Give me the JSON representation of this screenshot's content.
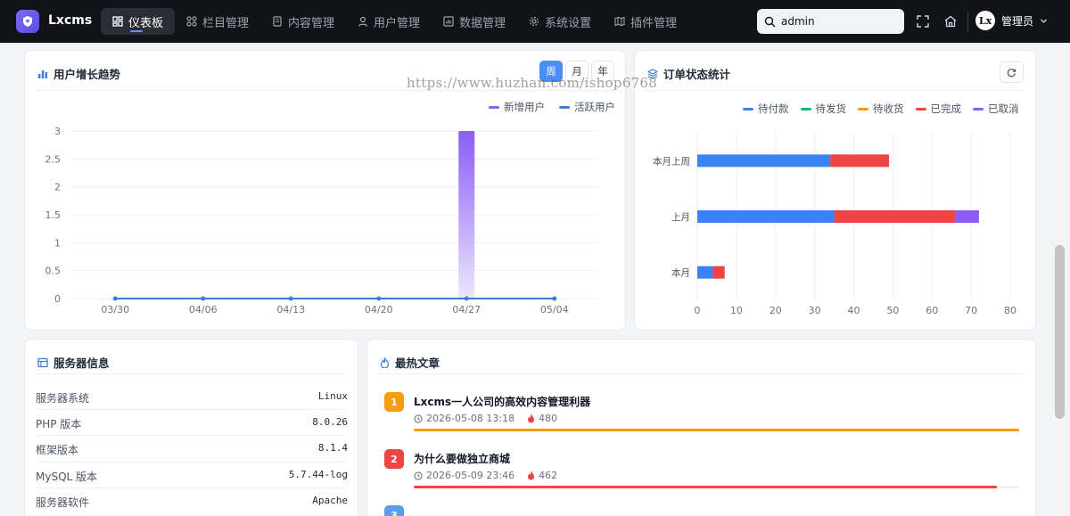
{
  "app": {
    "brand": "Lxcms"
  },
  "nav": [
    {
      "label": "仪表板",
      "icon": "dashboard-icon",
      "active": true
    },
    {
      "label": "栏目管理",
      "icon": "grid-icon"
    },
    {
      "label": "内容管理",
      "icon": "document-icon"
    },
    {
      "label": "用户管理",
      "icon": "user-icon"
    },
    {
      "label": "数据管理",
      "icon": "chart-icon"
    },
    {
      "label": "系统设置",
      "icon": "gear-icon"
    },
    {
      "label": "插件管理",
      "icon": "map-icon"
    }
  ],
  "search": {
    "value": "admin"
  },
  "user": {
    "name": "管理员",
    "avatar_text": "Lx"
  },
  "watermark": "https://www.huzhan.com/ishop6768",
  "growth": {
    "title": "用户增长趋势",
    "periods": [
      "周",
      "月",
      "年"
    ],
    "active_period": "周",
    "legend": [
      "新增用户",
      "活跃用户"
    ]
  },
  "orders": {
    "title": "订单状态统计",
    "legend": [
      "待付款",
      "待发货",
      "待收货",
      "已完成",
      "已取消"
    ]
  },
  "server": {
    "title": "服务器信息",
    "rows": [
      {
        "label": "服务器系统",
        "value": "Linux"
      },
      {
        "label": "PHP 版本",
        "value": "8.0.26"
      },
      {
        "label": "框架版本",
        "value": "8.1.4"
      },
      {
        "label": "MySQL 版本",
        "value": "5.7.44-log"
      },
      {
        "label": "服务器软件",
        "value": "Apache"
      }
    ]
  },
  "hot": {
    "title": "最热文章",
    "articles": [
      {
        "rank": "1",
        "title": "Lxcms一人公司的高效内容管理利器",
        "date": "2026-05-08 13:18",
        "views": "480",
        "ratio": 1.0,
        "color": "#f59e0b"
      },
      {
        "rank": "2",
        "title": "为什么要做独立商城",
        "date": "2026-05-09 23:46",
        "views": "462",
        "ratio": 0.9625,
        "color": "#ef4444"
      },
      {
        "rank": "3",
        "title": "",
        "date": "",
        "views": "",
        "ratio": 0,
        "color": "#5b9bf0"
      }
    ]
  },
  "colors": {
    "accent": "#4b8cf5",
    "new_users": "#8b5cf6",
    "active_users": "#3b7ddd",
    "pending_pay": "#3b82f6",
    "pending_ship": "#10b981",
    "pending_receive": "#f59e0b",
    "completed": "#ef4444",
    "cancelled": "#8b5cf6"
  },
  "chart_data": [
    {
      "type": "bar",
      "categories": [
        "03/30",
        "04/06",
        "04/13",
        "04/20",
        "04/27",
        "05/04"
      ],
      "series": [
        {
          "name": "新增用户",
          "type": "bar",
          "values": [
            0,
            0,
            0,
            0,
            3,
            0
          ]
        },
        {
          "name": "活跃用户",
          "type": "line",
          "values": [
            0,
            0,
            0,
            0,
            0,
            0
          ]
        }
      ],
      "ylim": [
        0,
        3
      ],
      "yticks": [
        "0",
        "0.5",
        "1",
        "1.5",
        "2",
        "2.5",
        "3"
      ],
      "legend": "top-right",
      "grid": true
    },
    {
      "type": "bar",
      "orientation": "horizontal",
      "stacked": true,
      "categories": [
        "本月上周",
        "上月",
        "本月"
      ],
      "series": [
        {
          "name": "待付款",
          "values": [
            34,
            35,
            4
          ]
        },
        {
          "name": "待发货",
          "values": [
            0,
            0,
            0
          ]
        },
        {
          "name": "待收货",
          "values": [
            0,
            0,
            0
          ]
        },
        {
          "name": "已完成",
          "values": [
            15,
            31,
            3
          ]
        },
        {
          "name": "已取消",
          "values": [
            0,
            6,
            0
          ]
        }
      ],
      "xlim": [
        0,
        80
      ],
      "xticks": [
        "0",
        "10",
        "20",
        "30",
        "40",
        "50",
        "60",
        "70",
        "80"
      ],
      "legend": "top-right",
      "grid": true
    }
  ]
}
